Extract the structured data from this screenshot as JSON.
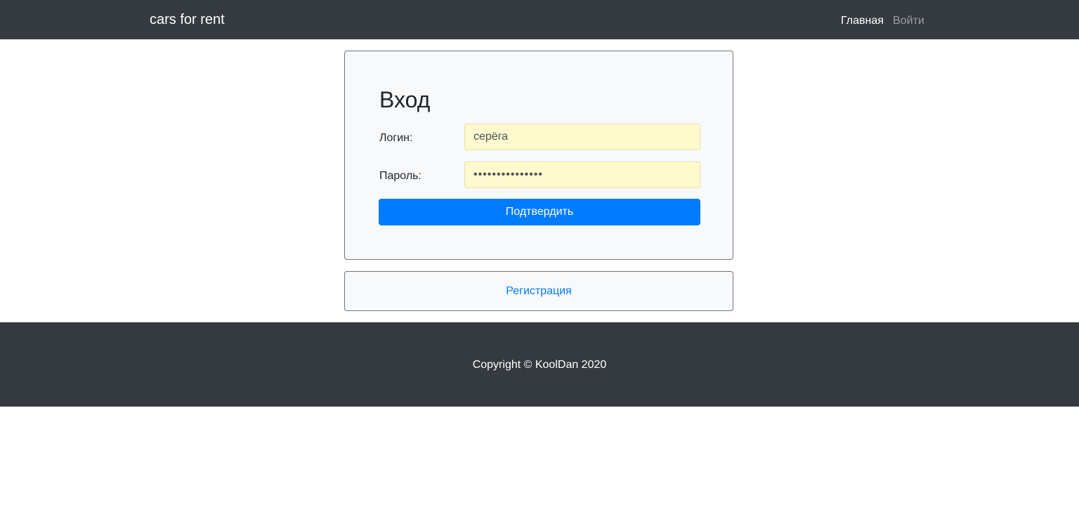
{
  "navbar": {
    "brand": "cars for rent",
    "links": [
      {
        "label": "Главная",
        "active": true
      },
      {
        "label": "Войти",
        "active": false
      }
    ]
  },
  "login_form": {
    "title": "Вход",
    "login_label": "Логин:",
    "login_value": "серёга",
    "password_label": "Пароль:",
    "password_value": "•••••••••••••••",
    "submit_label": "Подтвердить"
  },
  "register": {
    "link_label": "Регистрация"
  },
  "footer": {
    "copyright": "Copyright © KoolDan 2020"
  },
  "colors": {
    "navbar_bg": "#343a40",
    "primary": "#007bff",
    "autofill_bg": "#fffacd",
    "card_bg": "#f8f9fa"
  }
}
